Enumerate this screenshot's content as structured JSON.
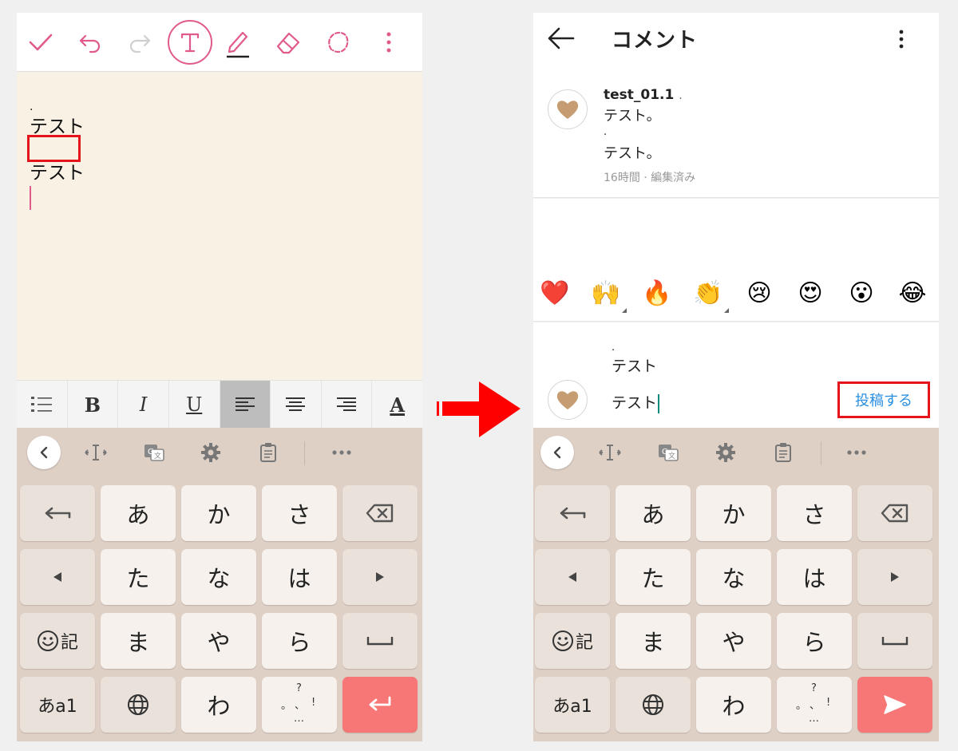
{
  "left": {
    "note_lines": [
      ".",
      "テスト",
      "テスト"
    ],
    "format_bar": {
      "bold": "B",
      "italic": "I",
      "underline": "U",
      "text_color": "A"
    }
  },
  "right": {
    "header_title": "コメント",
    "comment": {
      "username": "test_01.1",
      "user_dot": ".",
      "line1": "テスト。",
      "line2_dot": ".",
      "line3": "テスト。",
      "meta": "16時間 · 編集済み"
    },
    "emojis": [
      "❤️",
      "🙌",
      "🔥",
      "👏",
      "😢",
      "😍",
      "😮",
      "😂"
    ],
    "input": {
      "dot": ".",
      "line1": "テスト",
      "line2": "テスト"
    },
    "post_button": "投稿する"
  },
  "keyboard": {
    "row1": [
      "あ",
      "か",
      "さ"
    ],
    "row2": [
      "た",
      "な",
      "は"
    ],
    "row3": [
      "ま",
      "や",
      "ら"
    ],
    "row4": [
      "わ"
    ],
    "emoji_key": "記",
    "mode_key": "あa1",
    "punct": {
      "q": "?",
      "a": "。",
      "b": "、",
      "c": "!",
      "d": "…"
    }
  },
  "colors": {
    "accent_pink": "#e05a8c",
    "highlight_red": "#e5141b",
    "keyboard_bg": "#dfd0c6",
    "enter_key": "#f77676",
    "post_blue": "#2a8fe0"
  }
}
